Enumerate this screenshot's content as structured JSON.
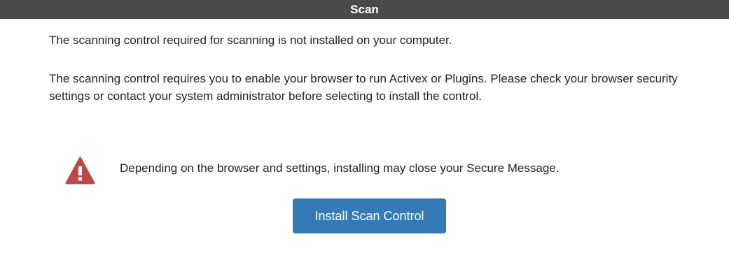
{
  "dialog": {
    "title": "Scan"
  },
  "messages": {
    "not_installed": "The scanning control required for scanning is not installed on your computer.",
    "requirements": "The scanning control requires you to enable your browser to run Activex or Plugins. Please check your browser security settings or contact your system administrator before selecting to install the control."
  },
  "warning": {
    "icon": "warning-triangle-icon",
    "icon_color": "#b94a48",
    "text": "Depending on the browser and settings, installing may close your Secure Message."
  },
  "actions": {
    "install_label": "Install Scan Control",
    "install_color": "#337ab7"
  },
  "colors": {
    "titlebar_bg": "#4a4a4a",
    "background": "#ffffff"
  }
}
